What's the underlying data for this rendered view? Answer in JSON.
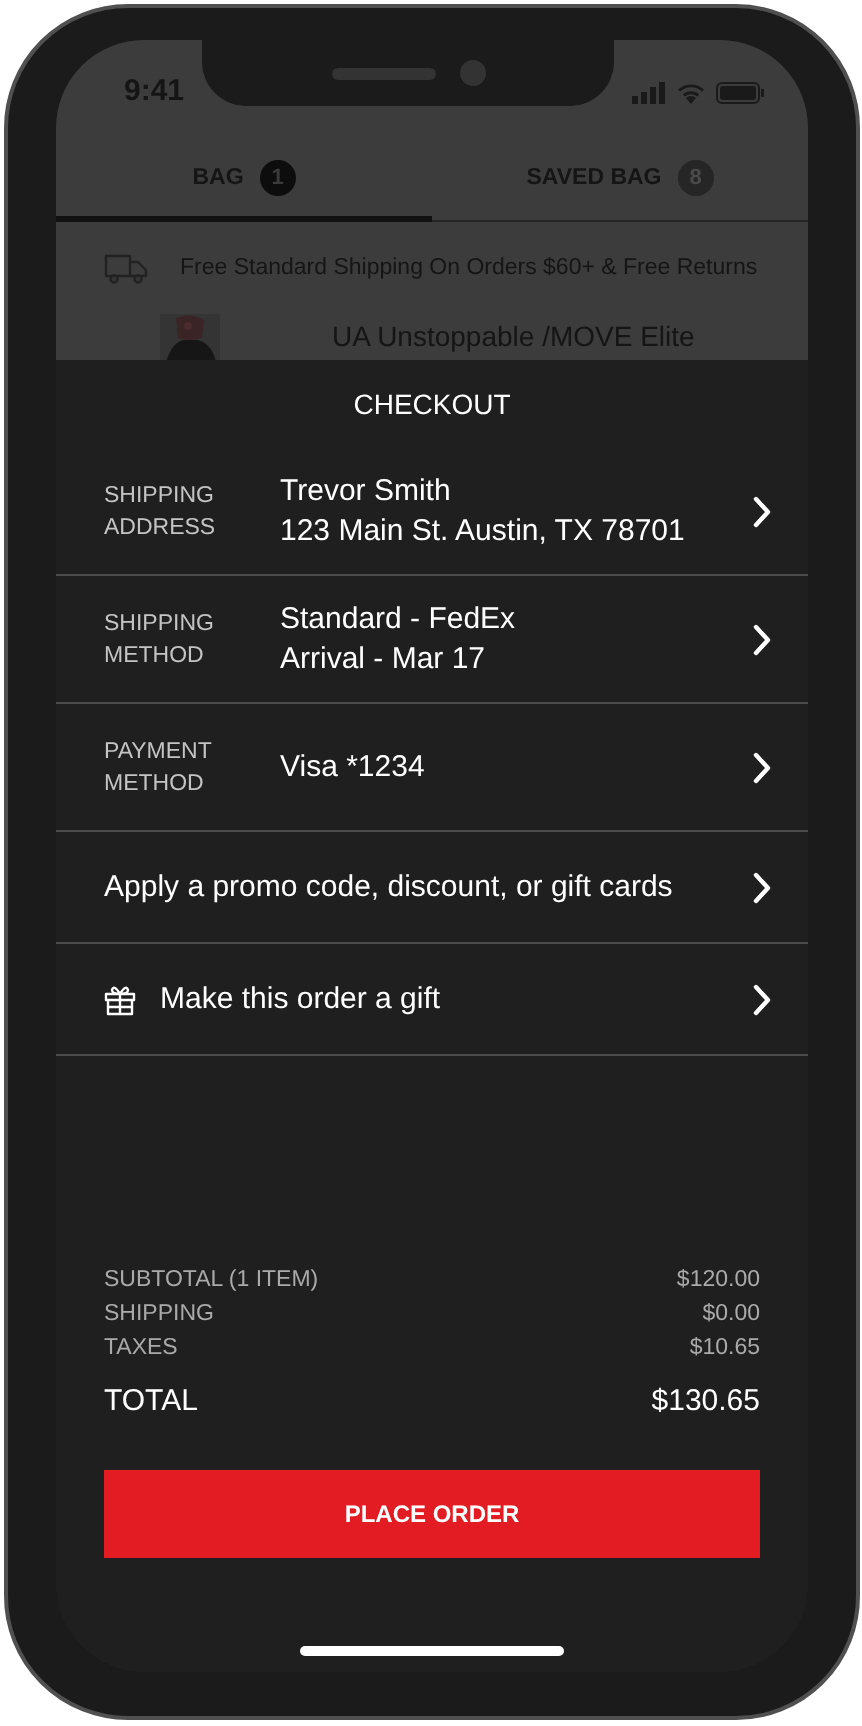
{
  "status_bar": {
    "time": "9:41"
  },
  "tabs": [
    {
      "label": "BAG",
      "count": "1",
      "selected": true
    },
    {
      "label": "SAVED BAG",
      "count": "8",
      "selected": false
    }
  ],
  "banner": {
    "text": "Free Standard Shipping On Orders $60+ & Free Returns"
  },
  "product": {
    "title": "UA Unstoppable /MOVE Elite"
  },
  "checkout": {
    "title": "CHECKOUT",
    "rows": [
      {
        "kind": "detail",
        "label": "SHIPPING ADDRESS",
        "lines": [
          "Trevor Smith",
          "123 Main St. Austin, TX 78701"
        ]
      },
      {
        "kind": "detail",
        "label": "SHIPPING METHOD",
        "lines": [
          "Standard - FedEx",
          "Arrival - Mar 17"
        ]
      },
      {
        "kind": "detail",
        "label": "PAYMENT METHOD",
        "lines": [
          "Visa *1234"
        ]
      },
      {
        "kind": "action",
        "text": "Apply a promo code, discount, or gift cards"
      },
      {
        "kind": "gift",
        "text": "Make this order a gift"
      }
    ],
    "summary": [
      {
        "label": "SUBTOTAL (1 ITEM)",
        "value": "$120.00"
      },
      {
        "label": "SHIPPING",
        "value": "$0.00"
      },
      {
        "label": "TAXES",
        "value": "$10.65"
      }
    ],
    "total": {
      "label": "TOTAL",
      "value": "$130.65"
    },
    "button": "PLACE ORDER"
  }
}
